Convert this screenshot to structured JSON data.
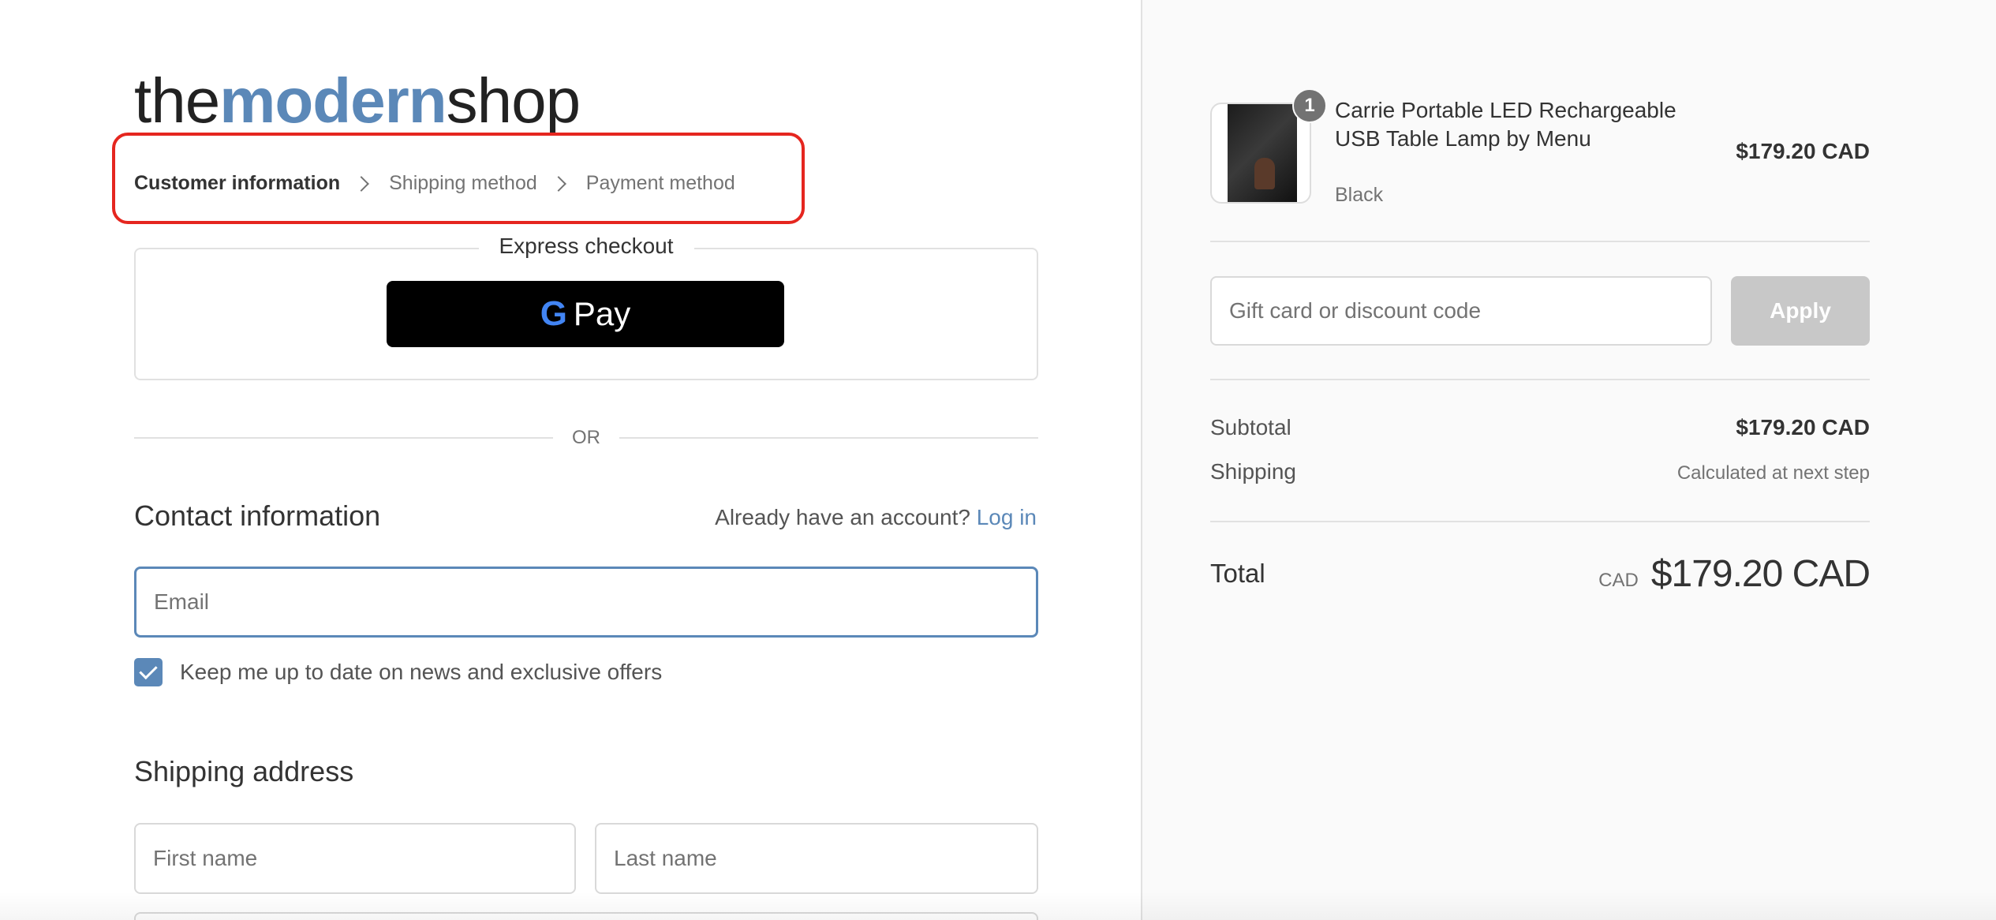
{
  "logo": {
    "part1": "the",
    "part2": "modern",
    "part3": "shop"
  },
  "breadcrumb": {
    "items": [
      "Customer information",
      "Shipping method",
      "Payment method"
    ]
  },
  "express": {
    "title": "Express checkout",
    "gpay_g": "G",
    "gpay_label": "Pay"
  },
  "divider": {
    "or": "OR"
  },
  "contact": {
    "title": "Contact information",
    "account_prompt": "Already have an account?",
    "login_label": "Log in",
    "email_placeholder": "Email",
    "newsletter_label": "Keep me up to date on news and exclusive offers",
    "newsletter_checked": true
  },
  "shipping_address": {
    "title": "Shipping address",
    "first_name_placeholder": "First name",
    "last_name_placeholder": "Last name"
  },
  "order": {
    "item": {
      "quantity": "1",
      "name": "Carrie Portable LED Rechargeable USB Table Lamp by Menu",
      "variant": "Black",
      "price": "$179.20 CAD"
    },
    "discount_placeholder": "Gift card or discount code",
    "apply_label": "Apply",
    "subtotal_label": "Subtotal",
    "subtotal_value": "$179.20 CAD",
    "shipping_label": "Shipping",
    "shipping_value": "Calculated at next step",
    "total_label": "Total",
    "total_currency": "CAD",
    "total_value": "$179.20 CAD"
  },
  "colors": {
    "accent": "#5b88b8",
    "highlight_border": "#e5261f",
    "apply_disabled": "#c8c8c8"
  }
}
